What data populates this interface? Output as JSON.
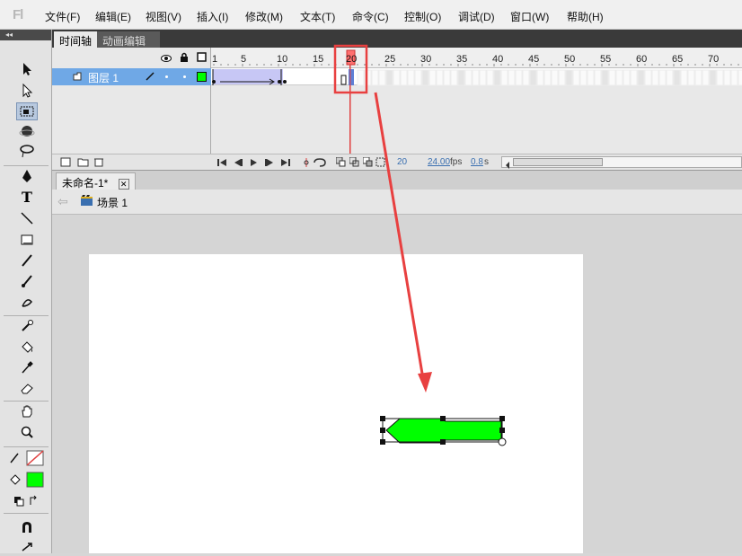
{
  "app": {
    "logo": "Fl"
  },
  "menu": [
    "文件(F)",
    "编辑(E)",
    "视图(V)",
    "插入(I)",
    "修改(M)",
    "文本(T)",
    "命令(C)",
    "控制(O)",
    "调试(D)",
    "窗口(W)",
    "帮助(H)"
  ],
  "panel_tabs": {
    "timeline": "时间轴",
    "motion_editor": "动画编辑器"
  },
  "toolbar_collapse": "◂◂",
  "layer": {
    "name": "图层 1"
  },
  "ruler_numbers": [
    "1",
    "5",
    "10",
    "15",
    "20",
    "25",
    "30",
    "35",
    "40",
    "45",
    "50",
    "55",
    "60",
    "65",
    "70"
  ],
  "playhead": {
    "frame": "20"
  },
  "footer": {
    "current_frame": "20",
    "fps": "24.00",
    "fps_unit": "fps",
    "time": "0.8",
    "time_unit": "s"
  },
  "document": {
    "tab_title": "未命名-1*",
    "close_glyph": "✕"
  },
  "scene": {
    "label": "场景 1",
    "back_glyph": "⇦"
  },
  "colors": {
    "menu_bg": "#f0f0f0",
    "layer_row": "#6fa8e6",
    "tween_fill": "#c7c7f5",
    "playhead": "#e04040",
    "fill_swatch": "#00ff00",
    "shape_fill": "#00ff00",
    "annotation": "#e84040"
  },
  "tools": [
    "selection-icon",
    "subselection-icon",
    "free-transform-icon",
    "3d-rotation-icon",
    "lasso-icon",
    "pen-icon",
    "text-icon",
    "line-icon",
    "rectangle-icon",
    "pencil-icon",
    "brush-icon",
    "deco-icon",
    "bone-icon",
    "paint-bucket-icon",
    "eyedropper-icon",
    "eraser-icon",
    "hand-icon",
    "zoom-icon",
    "stroke-color-icon",
    "fill-color-icon",
    "swap-colors-icon",
    "snap-icon"
  ]
}
